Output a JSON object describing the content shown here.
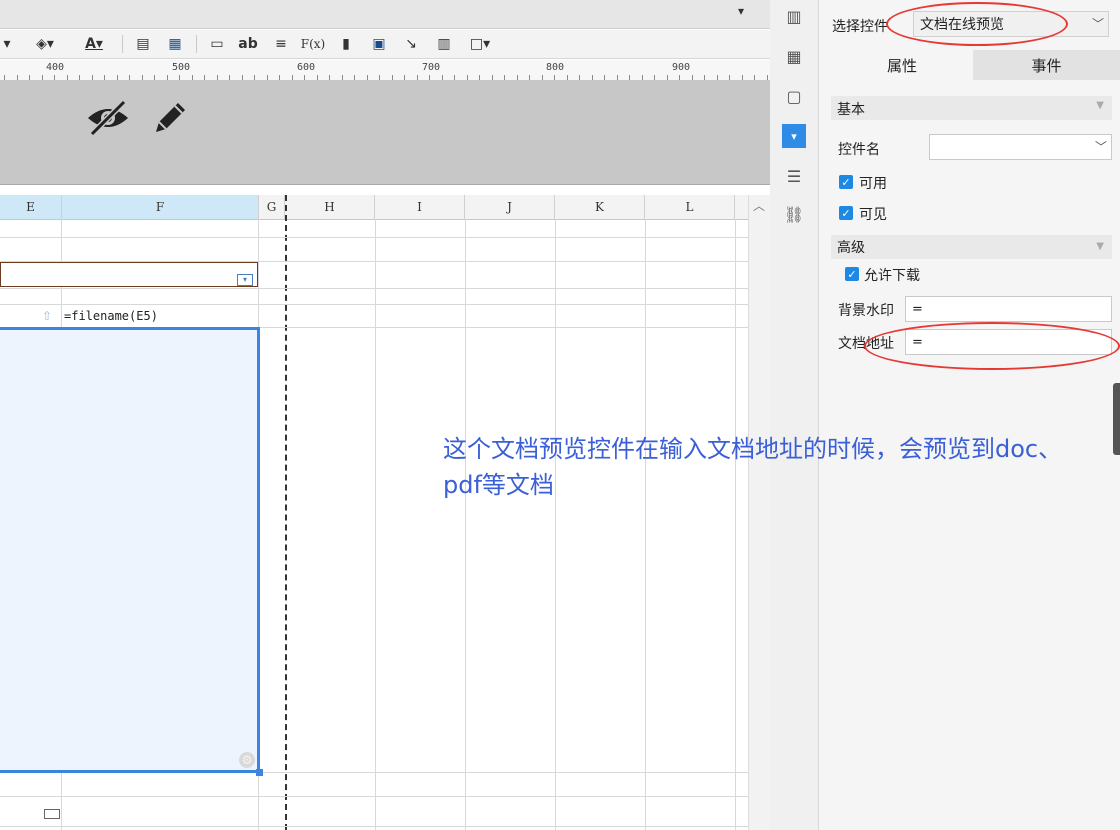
{
  "toolbar": {
    "buttons": [
      "▾",
      "◈▾",
      "A▾",
      "▤",
      "▦",
      "▭",
      "ab",
      "≡",
      "F(x)",
      "▮",
      "▣",
      "↘",
      "▥",
      "□▾"
    ]
  },
  "ruler": {
    "labels": [
      "400",
      "500",
      "600",
      "700",
      "800",
      "900"
    ]
  },
  "sheet": {
    "columns": [
      "E",
      "F",
      "G",
      "H",
      "I",
      "J",
      "K",
      "L"
    ],
    "formula_cell": "=filename(E5)"
  },
  "panel": {
    "select_control_label": "选择控件",
    "select_control_value": "文档在线预览",
    "tabs": {
      "properties": "属性",
      "events": "事件"
    },
    "basic_section": "基本",
    "control_name_label": "控件名",
    "control_name_value": "",
    "enabled_label": "可用",
    "visible_label": "可见",
    "advanced_section": "高级",
    "allow_download_label": "允许下载",
    "watermark_label": "背景水印",
    "watermark_value": "=",
    "doc_address_label": "文档地址",
    "doc_address_value": "="
  },
  "annotation": {
    "text": "这个文档预览控件在输入文档地址的时候，会预览到doc、pdf等文档"
  },
  "colors": {
    "accent": "#1e88e5",
    "annotation": "#3b5fd6",
    "highlight": "#e53935"
  }
}
